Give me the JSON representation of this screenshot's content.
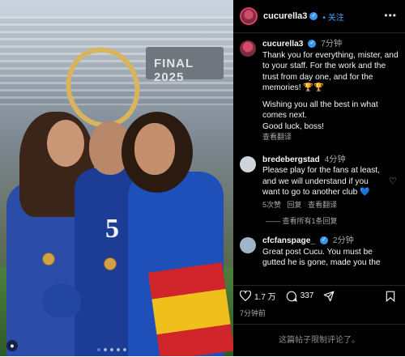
{
  "header": {
    "username": "cucurella3",
    "follow_label": "关注",
    "more_label": "•••"
  },
  "caption": {
    "username": "cucurella3",
    "time": "7分钟",
    "lines": [
      "Thank you for everything, mister, and",
      "to your staff. For the work and the",
      "trust from day one, and for the",
      "memories!",
      "Wishing you all the best in what",
      "comes next.",
      "Good luck, boss!"
    ],
    "emoji": "🏆🏆",
    "translate": "查看翻译"
  },
  "comments": [
    {
      "username": "bredebergstad",
      "time": "4分钟",
      "lines": [
        "Please play for the fans at least,",
        "and we will understand if you",
        "want to go to another club"
      ],
      "emoji": "💙",
      "likes": "5次赞",
      "reply": "回复",
      "translate": "查看翻译",
      "view_replies": "查看所有1条回复"
    },
    {
      "username": "cfcfanspage_",
      "time": "2分钟",
      "lines": [
        "Great post Cucu. You must be",
        "gutted he is gone, made you the"
      ]
    }
  ],
  "actions": {
    "likes": "1.7 万",
    "comments": "337"
  },
  "time_ago": "7分钟前",
  "footer": "这篇帖子限制评论了。",
  "photo": {
    "board_text": "FINAL 2025",
    "shirt_number": "5",
    "tag_icon": "person-icon"
  },
  "colors": {
    "accent": "#4aa3f7",
    "background": "#000000",
    "verified": "#3897f0"
  }
}
